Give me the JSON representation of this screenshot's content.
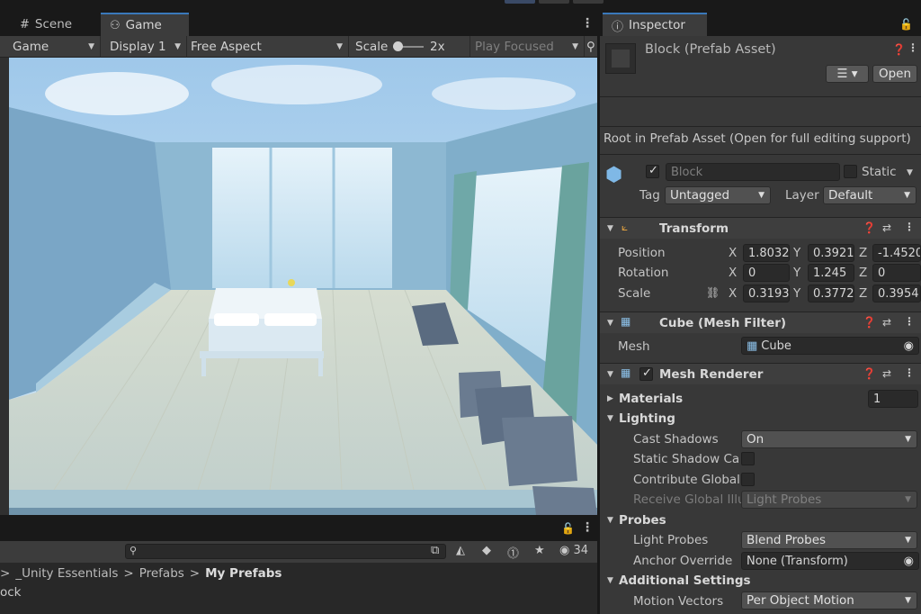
{
  "tabs": {
    "scene": "Scene",
    "game": "Game",
    "inspector": "Inspector"
  },
  "game_toolbar": {
    "mode": "Game",
    "display": "Display 1",
    "aspect": "Free Aspect",
    "scale_label": "Scale",
    "scale_value": "2x",
    "play_mode": "Play Focused"
  },
  "project": {
    "search_placeholder": "",
    "hidden_count": "34",
    "breadcrumbs": [
      "_Unity Essentials",
      "Prefabs",
      "My Prefabs"
    ],
    "asset_name": "ock"
  },
  "inspector": {
    "title": "Block (Prefab Asset)",
    "open_button": "Open",
    "root_note": "Root in Prefab Asset (Open for full editing support)",
    "object_name": "Block",
    "static_label": "Static",
    "tag_label": "Tag",
    "tag_value": "Untagged",
    "layer_label": "Layer",
    "layer_value": "Default",
    "transform": {
      "title": "Transform",
      "position_label": "Position",
      "rotation_label": "Rotation",
      "scale_label": "Scale",
      "position": {
        "x": "1.8032",
        "y": "0.3921",
        "z": "-1.4520"
      },
      "rotation": {
        "x": "0",
        "y": "1.245",
        "z": "0"
      },
      "scale": {
        "x": "0.3193",
        "y": "0.3772",
        "z": "0.3954"
      }
    },
    "mesh_filter": {
      "title": "Cube (Mesh Filter)",
      "mesh_label": "Mesh",
      "mesh_value": "Cube"
    },
    "mesh_renderer": {
      "title": "Mesh Renderer",
      "materials_label": "Materials",
      "materials_count": "1",
      "lighting_label": "Lighting",
      "cast_shadows_label": "Cast Shadows",
      "cast_shadows_value": "On",
      "static_shadow_label": "Static Shadow Cas",
      "contribute_gi_label": "Contribute Global",
      "receive_gi_label": "Receive Global Illu",
      "receive_gi_value": "Light Probes",
      "probes_label": "Probes",
      "light_probes_label": "Light Probes",
      "light_probes_value": "Blend Probes",
      "anchor_override_label": "Anchor Override",
      "anchor_override_value": "None (Transform)",
      "additional_settings_label": "Additional Settings",
      "motion_vectors_label": "Motion Vectors",
      "motion_vectors_value": "Per Object Motion"
    }
  },
  "colors": {
    "accent": "#3a79bb",
    "panel_bg": "#383838",
    "field_bg": "#2a2a2a",
    "window_bg": "#191919"
  }
}
